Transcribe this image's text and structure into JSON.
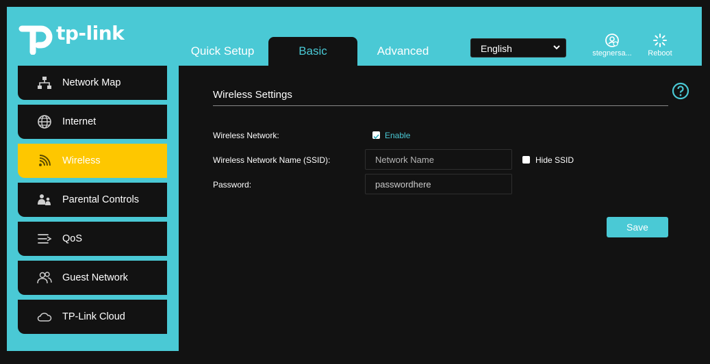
{
  "brand": {
    "name": "tp-link"
  },
  "nav": {
    "tabs": [
      {
        "label": "Quick Setup"
      },
      {
        "label": "Basic"
      },
      {
        "label": "Advanced"
      }
    ],
    "language": "English",
    "user_label": "stegnersa...",
    "reboot_label": "Reboot"
  },
  "sidebar": {
    "items": [
      {
        "label": "Network Map",
        "icon": "network-map-icon"
      },
      {
        "label": "Internet",
        "icon": "globe-icon"
      },
      {
        "label": "Wireless",
        "icon": "wifi-icon"
      },
      {
        "label": "Parental Controls",
        "icon": "parental-icon"
      },
      {
        "label": "QoS",
        "icon": "qos-icon"
      },
      {
        "label": "Guest Network",
        "icon": "guest-icon"
      },
      {
        "label": "TP-Link Cloud",
        "icon": "cloud-icon"
      }
    ],
    "active_index": 2
  },
  "main": {
    "section_title": "Wireless Settings",
    "wireless_network_label": "Wireless Network:",
    "enable_label": "Enable",
    "enable_checked": true,
    "ssid_label": "Wireless Network Name (SSID):",
    "ssid_placeholder": "Network Name",
    "hide_ssid_label": "Hide SSID",
    "hide_ssid_checked": false,
    "password_label": "Password:",
    "password_value": "passwordhere",
    "save_label": "Save"
  },
  "colors": {
    "accent": "#4ac9d5",
    "active_item": "#fec700",
    "panel_bg": "#121212"
  }
}
